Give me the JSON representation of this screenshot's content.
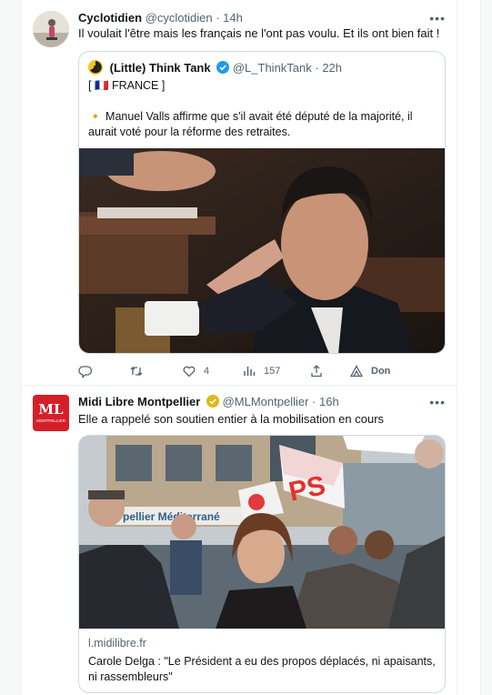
{
  "colors": {
    "accent": "#1d9bf0",
    "text": "#0f1419",
    "muted": "#536471",
    "gold": "#e2b719",
    "ml_red": "#d51f28"
  },
  "tweet1": {
    "author_name": "Cyclotidien",
    "meta": "@cyclotidien · 14h",
    "text": "Il voulait l'être mais les français ne l'ont pas voulu. Et ils ont bien fait !",
    "more_icon": "more-dots-icon",
    "quote": {
      "author_name": "(Little) Think Tank",
      "meta": "@L_ThinkTank · 22h",
      "line1": "[ 🇫🇷 FRANCE ]",
      "line2": "🔸 Manuel Valls affirme que s'il avait été député de la majorité, il aurait voté pour la réforme des retraites."
    },
    "actions": {
      "reply_count": "",
      "retweet_count": "",
      "like_count": "4",
      "views_count": "157",
      "share_label": "",
      "don_label": "Don"
    }
  },
  "tweet2": {
    "author_name": "Midi Libre Montpellier",
    "meta": "@MLMontpellier · 16h",
    "avatar_text": "ML",
    "avatar_sub": "MONTPELLIER",
    "text": "Elle a rappelé son soutien entier à la mobilisation en cours",
    "card": {
      "domain": "l.midilibre.fr",
      "title": "Carole Delga : \"Le Président a eu des propos déplacés, ni apaisants, ni rassembleurs\"",
      "sign_text": "PS",
      "building_text": "pellier Méditerrané"
    }
  }
}
